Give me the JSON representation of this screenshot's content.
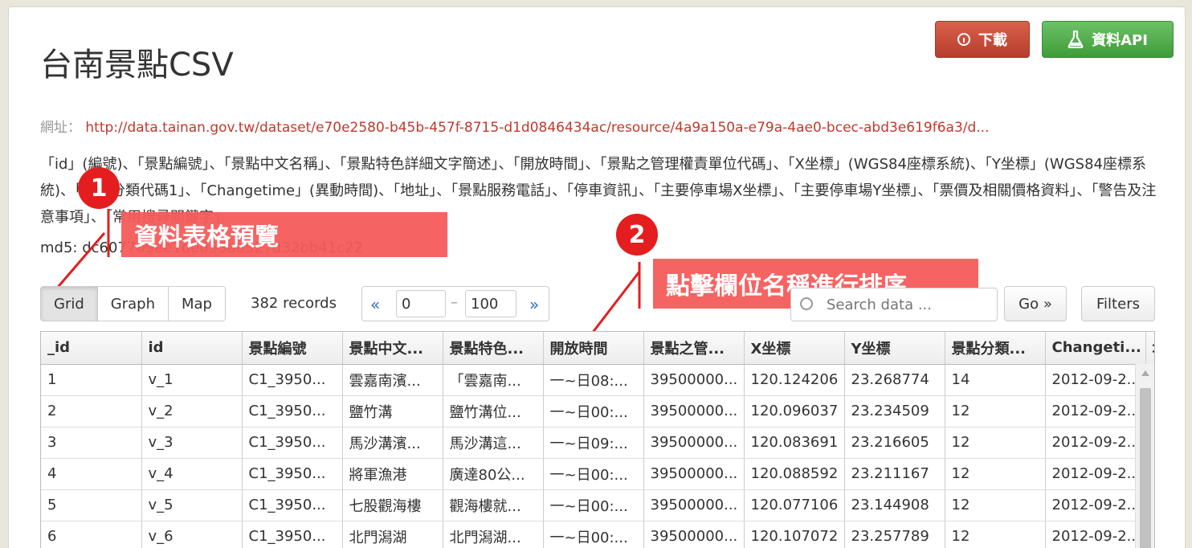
{
  "title": "台南景點CSV",
  "buttons": {
    "download": "下載",
    "api": "資料API"
  },
  "url": {
    "label": "網址：",
    "link": "http://data.tainan.gov.tw/dataset/e70e2580-b45b-457f-8715-d1d0846434ac/resource/4a9a150a-e79a-4ae0-bcec-abd3e619f6a3/d..."
  },
  "description": "「id」(編號)、「景點編號」、「景點中文名稱」、「景點特色詳細文字簡述」、「開放時間」、「景點之管理權責單位代碼」、「X坐標」(WGS84座標系統)、「Y坐標」(WGS84座標系統)、「景點分類代碼1」、「Changetime」(異動時間)、「地址」、「景點服務電話」、「停車資訊」、「主要停車場X坐標」、「主要停車場Y坐標」、「票價及相關價格資料」、「警告及注意事項」、「常用搜尋關鍵字」",
  "md5": "md5: dc607709ee1ded53aa527d32bb41c22",
  "annotations": {
    "badge1": "1",
    "label1": "資料表格預覽",
    "badge2": "2",
    "label2": "點擊欄位名稱進行排序"
  },
  "toolbar": {
    "views": [
      "Grid",
      "Graph",
      "Map"
    ],
    "records": "382 records",
    "prev": "«",
    "next": "»",
    "from": "0",
    "to": "100",
    "dash": "–",
    "search_placeholder": "Search data ...",
    "go": "Go »",
    "filters": "Filters"
  },
  "grid": {
    "columns": [
      "_id",
      "id",
      "景點編號",
      "景點中文...",
      "景點特色...",
      "開放時間",
      "景點之管...",
      "X坐標",
      "Y坐標",
      "景點分類...",
      "Changeti...",
      "地"
    ],
    "rows": [
      [
        "1",
        "v_1",
        "C1_3950...",
        "雲嘉南濱...",
        "「雲嘉南...",
        "一~日08:...",
        "39500000...",
        "120.124206",
        "23.268774",
        "14",
        "2012-09-2..."
      ],
      [
        "2",
        "v_2",
        "C1_3950...",
        "鹽竹溝",
        "鹽竹溝位...",
        "一~日00:...",
        "39500000...",
        "120.096037",
        "23.234509",
        "12",
        "2012-09-2..."
      ],
      [
        "3",
        "v_3",
        "C1_3950...",
        "馬沙溝濱...",
        "馬沙溝這...",
        "一~日09:...",
        "39500000...",
        "120.083691",
        "23.216605",
        "12",
        "2012-09-2..."
      ],
      [
        "4",
        "v_4",
        "C1_3950...",
        "將軍漁港",
        "廣達80公...",
        "一~日00:...",
        "39500000...",
        "120.088592",
        "23.211167",
        "12",
        "2012-09-2..."
      ],
      [
        "5",
        "v_5",
        "C1_3950...",
        "七股觀海樓",
        "觀海樓就...",
        "一~日00:...",
        "39500000...",
        "120.077106",
        "23.144908",
        "12",
        "2012-09-2..."
      ],
      [
        "6",
        "v_6",
        "C1_3950...",
        "北門潟湖",
        "北門潟湖...",
        "一~日00:...",
        "39500000...",
        "120.107072",
        "23.257789",
        "12",
        "2012-09-2..."
      ]
    ]
  },
  "colors": {
    "download": "#c9482f",
    "api": "#4cae45",
    "annotation": "#e41e1e",
    "link": "#c0392b"
  }
}
